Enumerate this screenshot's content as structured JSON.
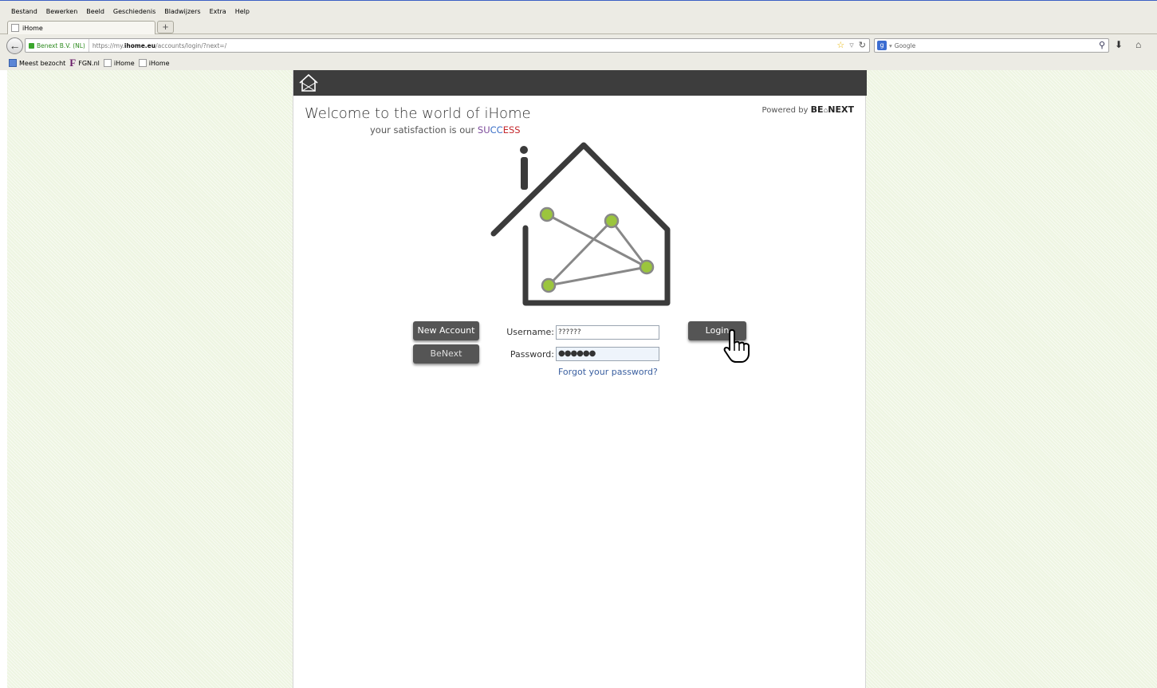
{
  "browser": {
    "menu": [
      "Bestand",
      "Bewerken",
      "Beeld",
      "Geschiedenis",
      "Bladwijzers",
      "Extra",
      "Help"
    ],
    "tab_title": "iHome",
    "new_tab": "+",
    "identity": "Benext B.V. (NL)",
    "url_prefix": "https://my.",
    "url_domain": "ihome.eu",
    "url_path": "/accounts/login/?next=/",
    "search_engine": "Google",
    "bookmarks": [
      "Meest bezocht",
      "FGN.nl",
      "iHome",
      "iHome"
    ]
  },
  "page": {
    "welcome": "Welcome to the world of iHome",
    "tagline_prefix": "your satisfaction is our ",
    "tagline_s1": "SU",
    "tagline_s2": "CC",
    "tagline_s3": "ESS",
    "powered_prefix": "Powered by ",
    "powered_brand_a": "BE",
    "powered_brand_b": "NEXT",
    "new_account": "New Account",
    "benext": "BeNext",
    "username_label": "Username:",
    "username_value": "??????",
    "password_label": "Password:",
    "password_value": "●●●●●●",
    "forgot": "Forgot your password?",
    "login": "Login"
  },
  "colors": {
    "topbar": "#3d3d3d",
    "node": "#9bc53d",
    "background": "#eef5e2"
  }
}
